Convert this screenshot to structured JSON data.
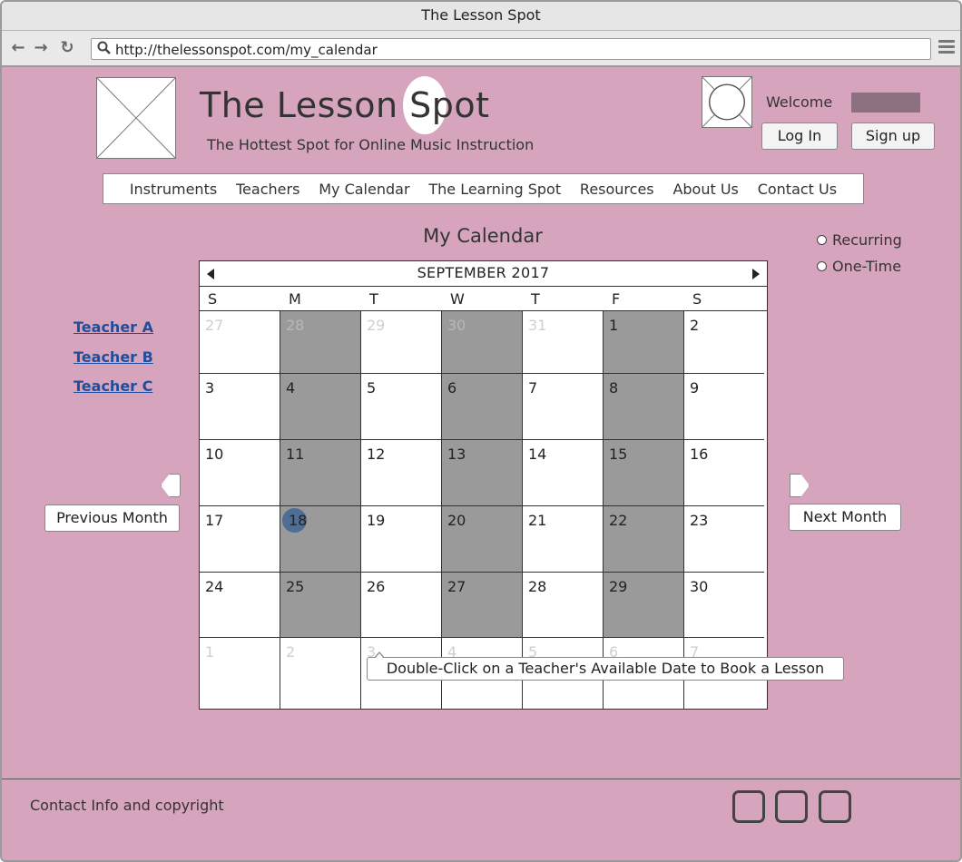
{
  "browser": {
    "window_title": "The Lesson Spot",
    "url": "http://thelessonspot.com/my_calendar"
  },
  "site": {
    "title": "The Lesson Spot",
    "tagline": "The Hottest Spot for Online Music Instruction"
  },
  "account": {
    "welcome_label": "Welcome",
    "login_label": "Log In",
    "signup_label": "Sign up"
  },
  "nav": {
    "items": [
      "Instruments",
      "Teachers",
      "My Calendar",
      "The Learning Spot",
      "Resources",
      "About Us",
      "Contact Us"
    ]
  },
  "page": {
    "heading": "My Calendar"
  },
  "booking_type": {
    "options": [
      "Recurring",
      "One-Time"
    ]
  },
  "teachers": [
    "Teacher A",
    "Teacher B",
    "Teacher C"
  ],
  "calendar": {
    "month_label": "SEPTEMBER 2017",
    "weekdays": [
      "S",
      "M",
      "T",
      "W",
      "T",
      "F",
      "S"
    ],
    "weeks": [
      [
        "27",
        "28",
        "29",
        "30",
        "31",
        "1",
        "2"
      ],
      [
        "3",
        "4",
        "5",
        "6",
        "7",
        "8",
        "9"
      ],
      [
        "10",
        "11",
        "12",
        "13",
        "14",
        "15",
        "16"
      ],
      [
        "17",
        "18",
        "19",
        "20",
        "21",
        "22",
        "23"
      ],
      [
        "24",
        "25",
        "26",
        "27",
        "28",
        "29",
        "30"
      ],
      [
        "1",
        "2",
        "3",
        "4",
        "5",
        "6",
        "7"
      ]
    ],
    "highlighted_day": "18",
    "available_weekdays": [
      "M",
      "W",
      "F"
    ]
  },
  "controls": {
    "previous_month_label": "Previous Month",
    "next_month_label": "Next Month"
  },
  "tooltip": {
    "text": "Double-Click on a Teacher's Available Date to Book a Lesson"
  },
  "footer": {
    "text": "Contact Info and copyright",
    "social_icons": [
      "social-icon",
      "social-icon",
      "social-icon"
    ]
  },
  "colors": {
    "page_background": "#d6a5bd",
    "available_day": "#9a9a9a",
    "today_marker": "#4e6e96",
    "link": "#1f4e9d"
  }
}
